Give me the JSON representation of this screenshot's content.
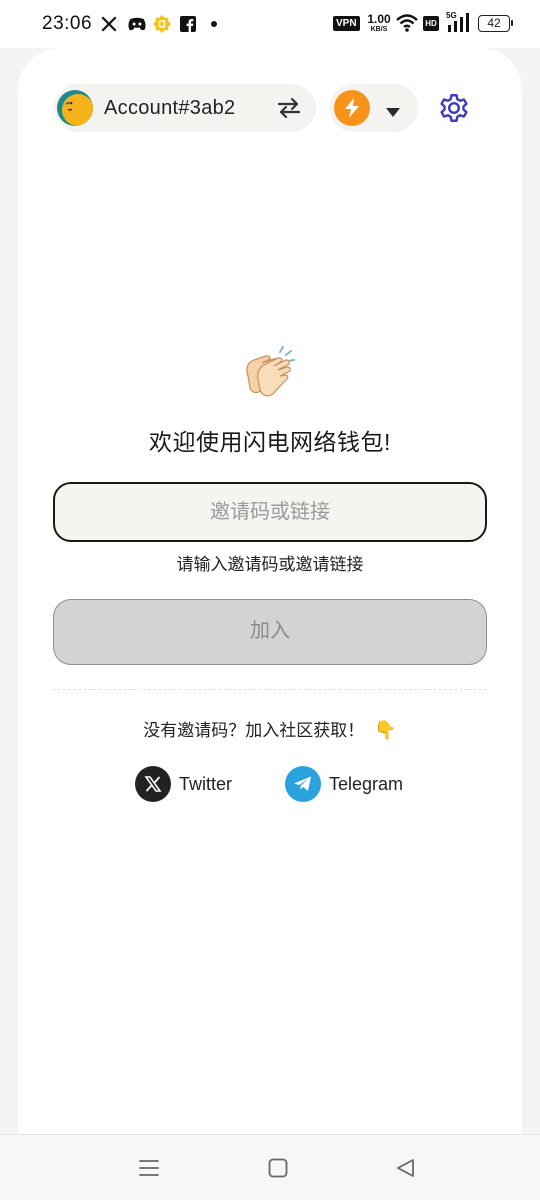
{
  "status_bar": {
    "time": "23:06",
    "vpn": "VPN",
    "speed_value": "1.00",
    "speed_unit": "KB/S",
    "hd": "HD",
    "network": "5G",
    "battery": "42"
  },
  "header": {
    "account_name": "Account#3ab2",
    "icons": [
      "avatar",
      "swap-icon",
      "lightning-icon",
      "caret-down-icon",
      "gear-icon"
    ]
  },
  "main": {
    "welcome_title": "欢迎使用闪电网络钱包!",
    "invite_placeholder": "邀请码或链接",
    "invite_value": "",
    "invite_hint": "请输入邀请码或邀请链接",
    "join_label": "加入",
    "community_text": "没有邀请码？加入社区获取！",
    "community_emoji": "👇"
  },
  "social": {
    "twitter_label": "Twitter",
    "telegram_label": "Telegram"
  },
  "colors": {
    "accent": "#3b3bc4",
    "bolt": "#f7931a",
    "telegram": "#2aa3dd",
    "join_disabled": "#d3d3d3"
  }
}
